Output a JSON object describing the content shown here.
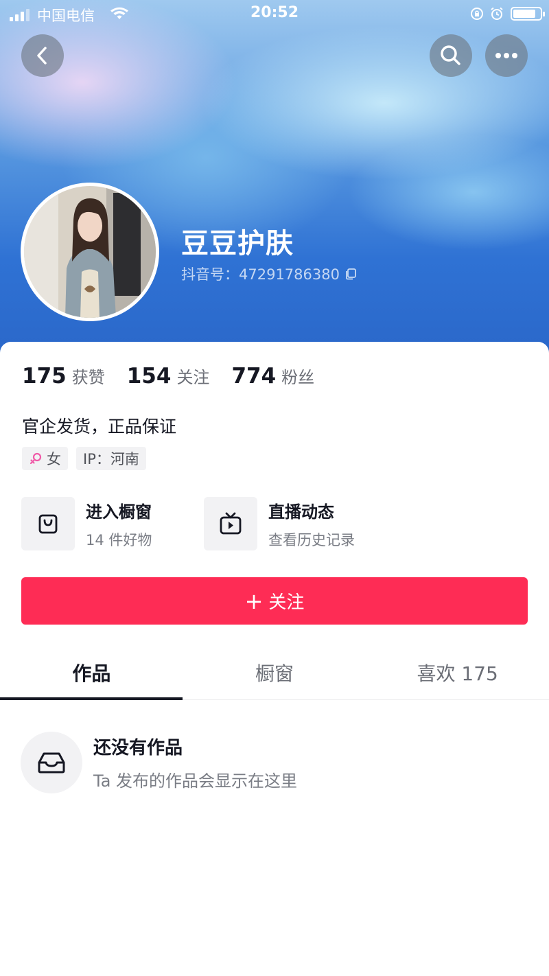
{
  "status_bar": {
    "carrier": "中国电信",
    "time": "20:52",
    "battery_level": 0.85
  },
  "nav": {
    "back_icon": "chevron-left-icon",
    "search_icon": "search-icon",
    "more_icon": "more-dots-icon"
  },
  "profile": {
    "name": "豆豆护肤",
    "douyin_id": "抖音号：47291786380"
  },
  "stats": [
    {
      "value": "175",
      "label": "获赞"
    },
    {
      "value": "154",
      "label": "关注"
    },
    {
      "value": "774",
      "label": "粉丝"
    }
  ],
  "bio": "官企发货，正品保证",
  "tags": {
    "gender": "女",
    "ip": "IP：河南"
  },
  "entries": [
    {
      "title": "进入橱窗",
      "subtitle": "14 件好物",
      "icon": "shopping-bag-icon"
    },
    {
      "title": "直播动态",
      "subtitle": "查看历史记录",
      "icon": "live-tv-icon"
    }
  ],
  "follow_button": {
    "plus": "+",
    "label": "关注"
  },
  "tabs": [
    {
      "label": "作品",
      "active": true
    },
    {
      "label": "橱窗",
      "active": false
    },
    {
      "label": "喜欢 175",
      "active": false
    }
  ],
  "empty_state": {
    "title": "还没有作品",
    "subtitle": "Ta 发布的作品会显示在这里",
    "icon": "inbox-tray-icon"
  },
  "colors": {
    "accent": "#fe2c55",
    "header_blue": "#2f72d4",
    "gender_female": "#f05aa8"
  }
}
